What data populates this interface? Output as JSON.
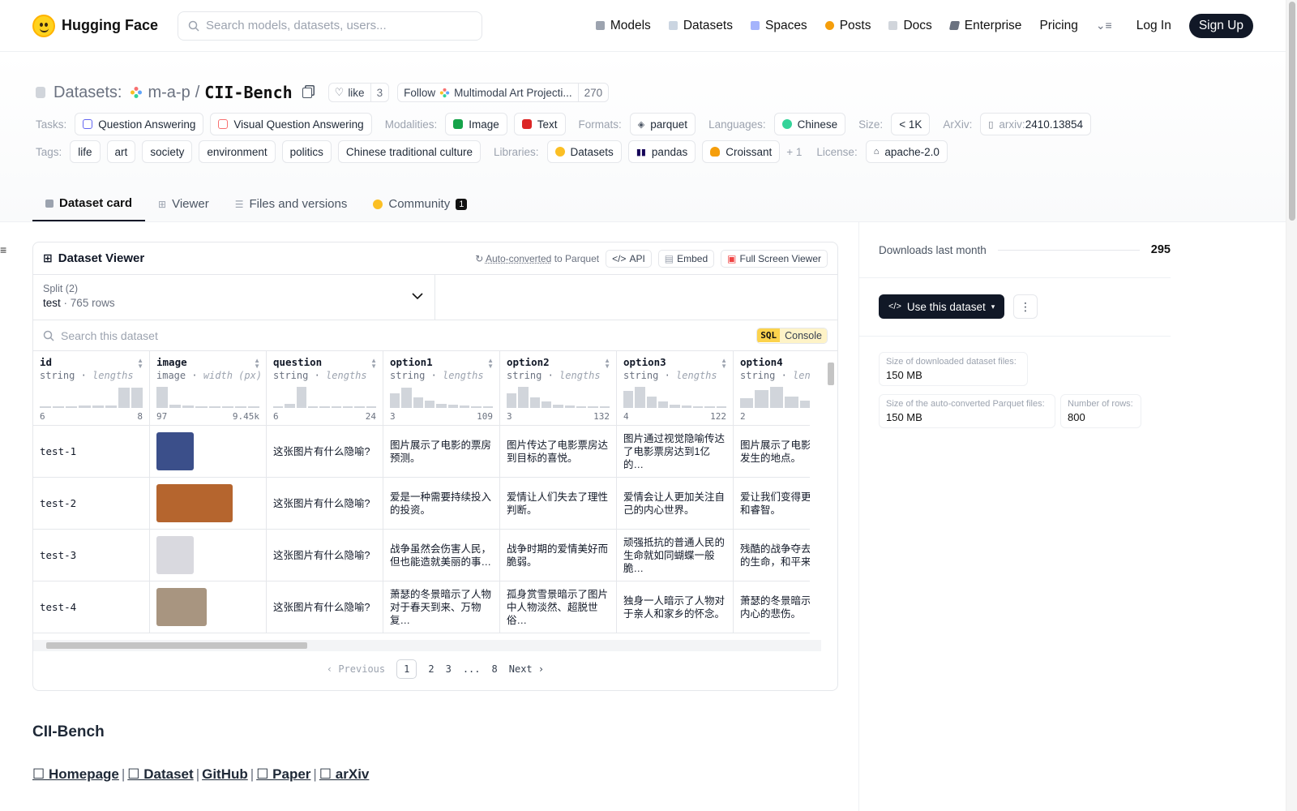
{
  "nav": {
    "brand": "Hugging Face",
    "search_placeholder": "Search models, datasets, users...",
    "links": [
      "Models",
      "Datasets",
      "Spaces",
      "Posts",
      "Docs",
      "Enterprise",
      "Pricing"
    ],
    "login": "Log In",
    "signup": "Sign Up"
  },
  "header": {
    "datasets_label": "Datasets:",
    "owner": "m-a-p",
    "slash": "/",
    "repo": "CII-Bench",
    "like_label": "like",
    "like_count": "3",
    "follow_label": "Follow",
    "org_name": "Multimodal Art Projecti...",
    "follow_count": "270",
    "tasks_key": "Tasks:",
    "tasks": [
      "Question Answering",
      "Visual Question Answering"
    ],
    "modalities_key": "Modalities:",
    "modalities": [
      "Image",
      "Text"
    ],
    "formats_key": "Formats:",
    "formats": [
      "parquet"
    ],
    "languages_key": "Languages:",
    "languages": [
      "Chinese"
    ],
    "size_key": "Size:",
    "size": "< 1K",
    "arxiv_key": "ArXiv:",
    "arxiv_prefix": "arxiv:",
    "arxiv_id": "2410.13854",
    "tags_key": "Tags:",
    "tags": [
      "life",
      "art",
      "society",
      "environment",
      "politics",
      "Chinese traditional culture"
    ],
    "libraries_key": "Libraries:",
    "libraries": [
      "Datasets",
      "pandas",
      "Croissant"
    ],
    "libraries_more": "+ 1",
    "license_key": "License:",
    "license": "apache-2.0"
  },
  "tabs": [
    {
      "label": "Dataset card",
      "active": true
    },
    {
      "label": "Viewer"
    },
    {
      "label": "Files and versions"
    },
    {
      "label": "Community",
      "badge": "1"
    }
  ],
  "viewer": {
    "title": "Dataset Viewer",
    "auto_converted": "Auto-converted",
    "to_parquet": "to Parquet",
    "api": "API",
    "embed": "Embed",
    "full_screen": "Full Screen Viewer",
    "split_label": "Split (2)",
    "split_name": "test",
    "split_sep": "·",
    "split_rows": "765 rows",
    "search_placeholder": "Search this dataset",
    "sql_key": "SQL",
    "sql_console": "Console",
    "columns": [
      {
        "name": "id",
        "type": "string",
        "stat": "lengths",
        "min": "6",
        "max": "8",
        "hist": [
          0.05,
          0.05,
          0.05,
          0.1,
          0.1,
          0.1,
          0.95,
          0.95
        ]
      },
      {
        "name": "image",
        "type": "image",
        "stat": "width (px)",
        "min": "97",
        "max": "9.45k",
        "hist": [
          1.0,
          0.15,
          0.1,
          0.05,
          0.05,
          0.05,
          0.05,
          0.05
        ]
      },
      {
        "name": "question",
        "type": "string",
        "stat": "lengths",
        "min": "6",
        "max": "24",
        "hist": [
          0.05,
          0.2,
          1.0,
          0.05,
          0.05,
          0.05,
          0.05,
          0.05,
          0.05
        ]
      },
      {
        "name": "option1",
        "type": "string",
        "stat": "lengths",
        "min": "3",
        "max": "109",
        "hist": [
          0.7,
          0.95,
          0.5,
          0.35,
          0.2,
          0.15,
          0.1,
          0.05,
          0.05
        ]
      },
      {
        "name": "option2",
        "type": "string",
        "stat": "lengths",
        "min": "3",
        "max": "132",
        "hist": [
          0.7,
          1.0,
          0.5,
          0.3,
          0.15,
          0.1,
          0.05,
          0.05,
          0.05
        ]
      },
      {
        "name": "option3",
        "type": "string",
        "stat": "lengths",
        "min": "4",
        "max": "122",
        "hist": [
          0.8,
          1.0,
          0.55,
          0.3,
          0.15,
          0.1,
          0.05,
          0.05,
          0.05
        ]
      },
      {
        "name": "option4",
        "type": "string",
        "stat": "lengths",
        "min": "2",
        "max": "",
        "hist": [
          0.45,
          0.85,
          1.0,
          0.55,
          0.35,
          0.2,
          0.1
        ]
      }
    ],
    "rows": [
      {
        "id": "test-1",
        "question": "这张图片有什么隐喻?",
        "option1": "图片展示了电影的票房预测。",
        "option2": "图片传达了电影票房达到目标的喜悦。",
        "option3": "图片通过视觉隐喻传达了电影票房达到1亿的…",
        "option4": "图片展示了电影拍摄的发生的地点。",
        "thumb": "#3b4f8a"
      },
      {
        "id": "test-2",
        "question": "这张图片有什么隐喻?",
        "option1": "爱是一种需要持续投入的投资。",
        "option2": "爱情让人们失去了理性判断。",
        "option3": "爱情会让人更加关注自己的内心世界。",
        "option4": "爱让我们变得更加勇敢和睿智。",
        "thumb": "#b5652e"
      },
      {
        "id": "test-3",
        "question": "这张图片有什么隐喻?",
        "option1": "战争虽然会伤害人民，但也能造就美丽的事…",
        "option2": "战争时期的爱情美好而脆弱。",
        "option3": "顽强抵抗的普通人民的生命就如同蝴蝶一般脆…",
        "option4": "残酷的战争夺去了人民的生命，和平来之不易",
        "thumb": "#d9d9df"
      },
      {
        "id": "test-4",
        "question": "这张图片有什么隐喻?",
        "option1": "萧瑟的冬景暗示了人物对于春天到来、万物复…",
        "option2": "孤身赏雪景暗示了图片中人物淡然、超脱世俗…",
        "option3": "独身一人暗示了人物对于亲人和家乡的怀念。",
        "option4": "萧瑟的冬景暗示了人物内心的悲伤。",
        "thumb": "#a89580"
      }
    ],
    "pager": {
      "previous": "Previous",
      "pages": [
        "1",
        "2",
        "3",
        "...",
        "8"
      ],
      "current": "1",
      "next": "Next"
    }
  },
  "readme": {
    "title": "CII-Bench",
    "links": [
      "☐ Homepage",
      "☐ Dataset",
      "GitHub",
      "☐ Paper",
      "☐ arXiv"
    ],
    "sep": "|"
  },
  "sidebar": {
    "downloads_label": "Downloads last month",
    "downloads_value": "295",
    "use_dataset": "Use this dataset",
    "size_downloaded_label": "Size of downloaded dataset files:",
    "size_downloaded_value": "150 MB",
    "size_parquet_label": "Size of the auto-converted Parquet files:",
    "size_parquet_value": "150 MB",
    "num_rows_label": "Number of rows:",
    "num_rows_value": "800"
  }
}
